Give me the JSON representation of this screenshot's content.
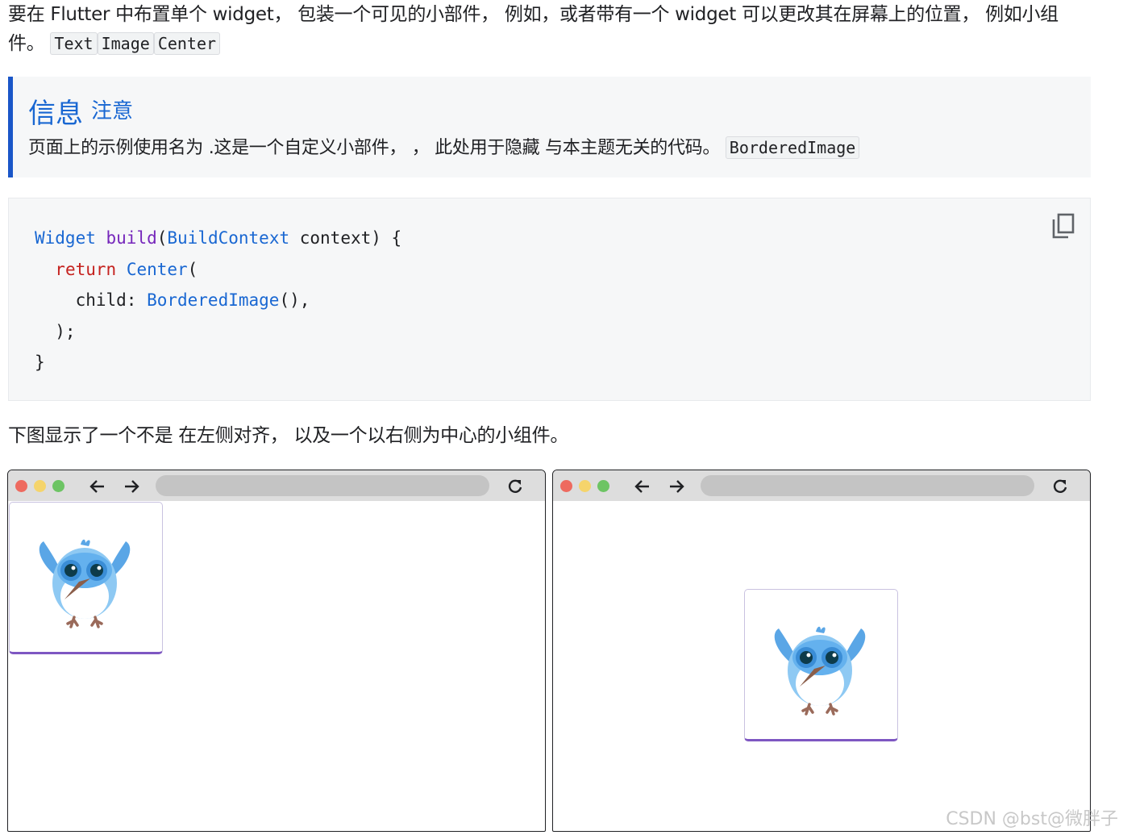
{
  "intro": {
    "text_1": "要在 Flutter 中布置单个 widget， 包装一个可见的小部件， 例如，或者带有一个 widget 可以更改其在屏幕上的位置， 例如小组件。",
    "codes": [
      "Text",
      "Image",
      "Center"
    ]
  },
  "callout": {
    "title": "信息",
    "subtitle": "注意",
    "body": "页面上的示例使用名为 .这是一个自定义小部件， ， 此处用于隐藏 与本主题无关的代码。",
    "code": "BorderedImage"
  },
  "code_block": {
    "lines": [
      [
        {
          "t": "Widget",
          "c": "type"
        },
        {
          "t": " ",
          "c": ""
        },
        {
          "t": "build",
          "c": "fn"
        },
        {
          "t": "(",
          "c": ""
        },
        {
          "t": "BuildContext",
          "c": "type"
        },
        {
          "t": " context) {",
          "c": ""
        }
      ],
      [
        {
          "t": "  ",
          "c": ""
        },
        {
          "t": "return",
          "c": "kw"
        },
        {
          "t": " ",
          "c": ""
        },
        {
          "t": "Center",
          "c": "type"
        },
        {
          "t": "(",
          "c": ""
        }
      ],
      [
        {
          "t": "    child: ",
          "c": ""
        },
        {
          "t": "BorderedImage",
          "c": "type"
        },
        {
          "t": "(),",
          "c": ""
        }
      ],
      [
        {
          "t": "  );",
          "c": ""
        }
      ],
      [
        {
          "t": "}",
          "c": ""
        }
      ]
    ],
    "copy_icon": "copy-icon"
  },
  "description": "下图显示了一个不是 在左侧对齐， 以及一个以右侧为中心的小组件。",
  "browsers": [
    {
      "alignment": "left",
      "image_alignment": "top-left"
    },
    {
      "alignment": "right",
      "image_alignment": "center"
    }
  ],
  "icons": [
    "back-arrow-icon",
    "forward-arrow-icon",
    "reload-icon",
    "copy-icon",
    "dash-bird-image"
  ],
  "colors": {
    "accent": "#1a56c8",
    "code_type": "#1967d2",
    "code_fn": "#7627bb",
    "code_keyword": "#c5221f",
    "card_border": "#7e57c2",
    "traffic_red": "#ee6a5f",
    "traffic_yellow": "#f5d46b",
    "traffic_green": "#6dc464"
  },
  "watermark": "CSDN @bst@微胖子"
}
